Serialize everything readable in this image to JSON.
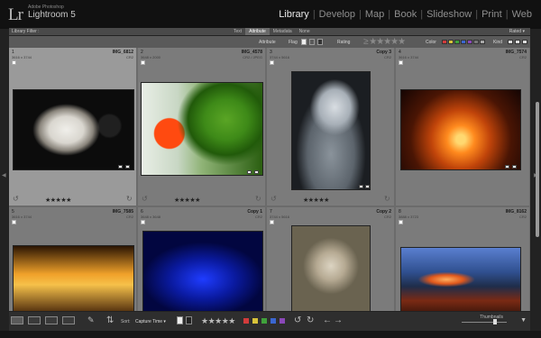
{
  "header": {
    "logo_initials": "Lr",
    "maker": "Adobe Photoshop",
    "product": "Lightroom 5",
    "modules": [
      {
        "label": "Library",
        "active": true
      },
      {
        "label": "Develop",
        "active": false
      },
      {
        "label": "Map",
        "active": false
      },
      {
        "label": "Book",
        "active": false
      },
      {
        "label": "Slideshow",
        "active": false
      },
      {
        "label": "Print",
        "active": false
      },
      {
        "label": "Web",
        "active": false
      }
    ],
    "separator": "|"
  },
  "filter_bar": {
    "label": "Library Filter :",
    "tabs": [
      {
        "label": "Text",
        "active": false
      },
      {
        "label": "Attribute",
        "active": true
      },
      {
        "label": "Metadata",
        "active": false
      },
      {
        "label": "None",
        "active": false
      }
    ],
    "preset_label": "Rated ▾"
  },
  "attribute_bar": {
    "attribute_label": "Attribute",
    "flag_label": "Flag",
    "rating_label": "Rating",
    "rating_stars": "≥ ★★★★★",
    "color_label": "Color",
    "kind_label": "Kind",
    "color_chips": [
      "#d23b3b",
      "#d8c33a",
      "#3fa13b",
      "#3a66d0",
      "#8a48b8",
      "#777777",
      "#aaaaaa"
    ]
  },
  "grid": {
    "cells": [
      {
        "index": "1",
        "dims": "3616 x 3744",
        "filename": "IMG_6812",
        "filetype": "CR2",
        "rating": "★★★★★",
        "selected": true,
        "photo": "parrot-grey-closeup"
      },
      {
        "index": "2",
        "dims": "3648 x 2000",
        "filename": "IMG_4578",
        "filetype": "CR2 / JPEG",
        "rating": "★★★★★",
        "selected": false,
        "photo": "green-parrot"
      },
      {
        "index": "3",
        "dims": "3744 x 5616",
        "filename": "Copy 3",
        "filetype": "CR2",
        "rating": "★★★★★",
        "selected": false,
        "photo": "grey-parrot-portrait"
      },
      {
        "index": "4",
        "dims": "3616 x 3744",
        "filename": "IMG_7574",
        "filetype": "CR2",
        "rating": "",
        "selected": false,
        "photo": "sunset-grass"
      },
      {
        "index": "5",
        "dims": "3616 x 3744",
        "filename": "IMG_7585",
        "filetype": "CR2",
        "rating": "",
        "selected": false,
        "photo": "sunset-grass-2"
      },
      {
        "index": "6",
        "dims": "3648 x 3648",
        "filename": "Copy 1",
        "filetype": "CR2",
        "rating": "",
        "selected": false,
        "photo": "blue-gradient"
      },
      {
        "index": "7",
        "dims": "3744 x 5616",
        "filename": "Copy 2",
        "filetype": "CR2",
        "rating": "",
        "selected": false,
        "photo": "statue"
      },
      {
        "index": "8",
        "dims": "3888 x 3723",
        "filename": "IMG_8162",
        "filetype": "CR2",
        "rating": "",
        "selected": false,
        "photo": "light-trails"
      }
    ]
  },
  "toolbar": {
    "sort_label": "Sort:",
    "sort_value": "Capture Time ▾",
    "stars": "★★★★★",
    "color_chips": [
      "#d23b3b",
      "#d8c33a",
      "#3fa13b",
      "#3a66d0",
      "#8a48b8"
    ],
    "thumbnails_label": "Thumbnails"
  }
}
